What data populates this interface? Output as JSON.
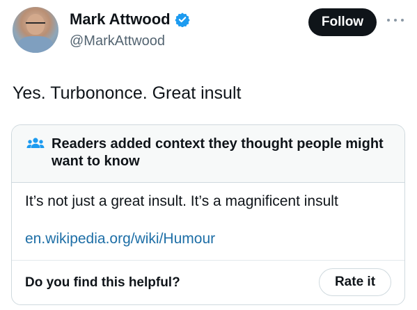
{
  "user": {
    "display_name": "Mark Attwood",
    "handle": "@MarkAttwood",
    "verified_icon": "verified-badge-icon",
    "avatar_icon": "avatar"
  },
  "actions": {
    "follow_label": "Follow",
    "more_icon": "more-options-icon"
  },
  "tweet": {
    "text": "Yes. Turbononce. Great insult"
  },
  "community_note": {
    "icon": "people-icon",
    "title": "Readers added context they thought people might want to know",
    "body": "It’s not just a great insult. It’s a magnificent insult",
    "link_text": "en.wikipedia.org/wiki/Humour",
    "helpful_question": "Do you find this helpful?",
    "rate_label": "Rate it"
  },
  "colors": {
    "accent_blue": "#1d9bf0",
    "link_blue": "#1d6ea6",
    "text_primary": "#0f1419",
    "text_secondary": "#536471",
    "border": "#cfd9de",
    "note_header_bg": "#f7f9f9"
  }
}
